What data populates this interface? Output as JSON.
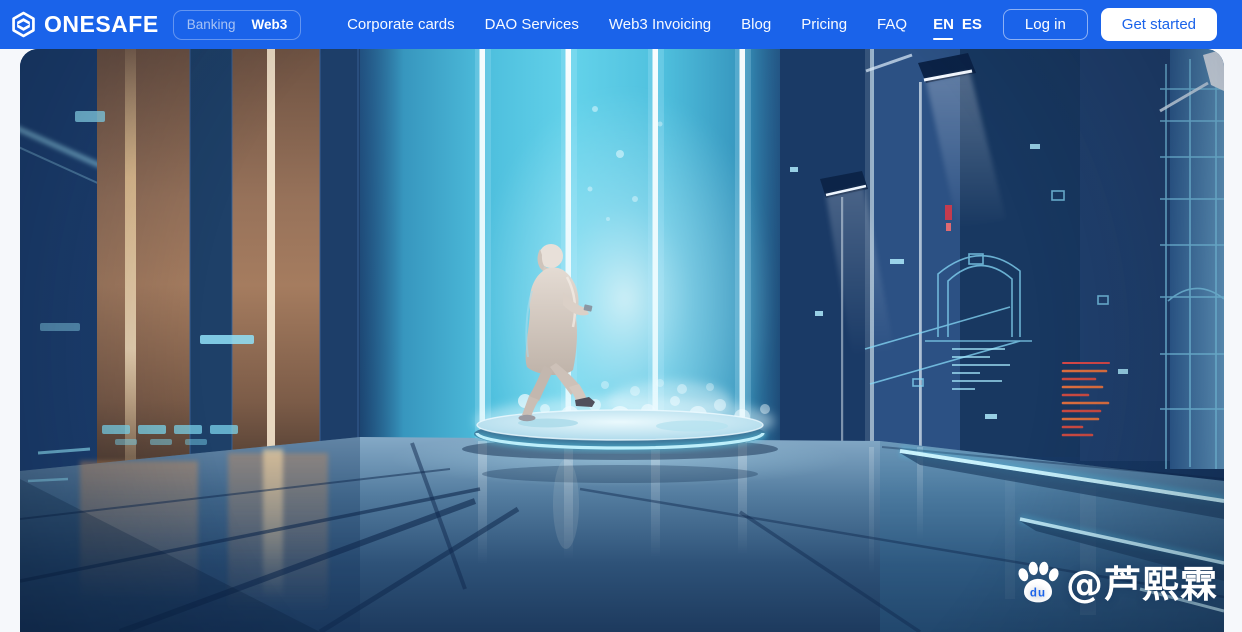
{
  "colors": {
    "header_background": "#1a63ea",
    "header_text": "#ffffff",
    "cta_background": "#ffffff",
    "cta_text": "#1a63ea",
    "hero_cyan_glow": "#5ccbe8",
    "hero_deep_navy": "#16345e",
    "hero_warm_panel": "#9a7358"
  },
  "header": {
    "logo": {
      "text": "ONESAFE",
      "icon": "onesafe-hexagon-logo"
    },
    "product_toggle": {
      "options": [
        {
          "label": "Banking",
          "active": false
        },
        {
          "label": "Web3",
          "active": true
        }
      ]
    },
    "nav": [
      {
        "label": "Corporate cards"
      },
      {
        "label": "DAO Services"
      },
      {
        "label": "Web3 Invoicing"
      },
      {
        "label": "Blog"
      },
      {
        "label": "Pricing"
      },
      {
        "label": "FAQ"
      }
    ],
    "language": {
      "options": [
        {
          "code": "EN",
          "selected": true
        },
        {
          "code": "ES",
          "selected": false
        }
      ]
    },
    "login_label": "Log in",
    "get_started_label": "Get started"
  },
  "hero": {
    "alt": "Futuristic blue corridor with glowing light columns and a person walking across an illuminated circular platform",
    "watermark": {
      "icon": "baidu-paw-icon",
      "icon_text": "du",
      "text": "@芦熙霖"
    }
  }
}
